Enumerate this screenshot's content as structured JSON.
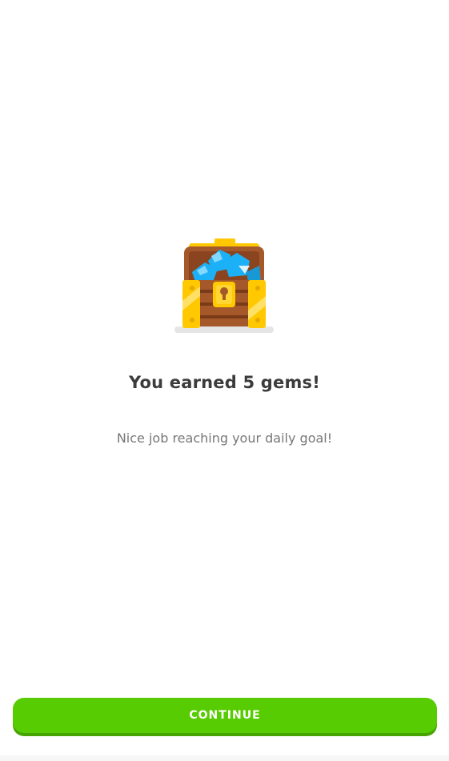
{
  "reward": {
    "title": "You earned 5 gems!",
    "message": "Nice job reaching your daily goal!",
    "icon": "treasure-chest-gems-icon"
  },
  "actions": {
    "continue_label": "CONTINUE"
  },
  "colors": {
    "primary_button": "#58cc02",
    "primary_button_shadow": "#46a302",
    "title_text": "#3c3c3c",
    "body_text": "#777777",
    "gem": "#1cb0f6",
    "chest_gold": "#ffc800",
    "chest_wood": "#a5582a"
  }
}
